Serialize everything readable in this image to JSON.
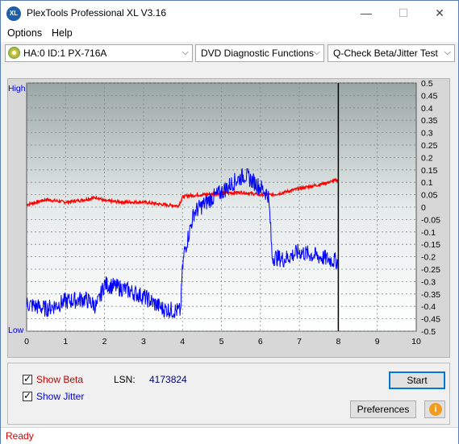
{
  "window": {
    "title": "PlexTools Professional XL V3.16",
    "icon_text": "XL"
  },
  "controls": {
    "minimize": "—",
    "maximize": "☐",
    "close": "✕"
  },
  "menu": {
    "options": "Options",
    "help": "Help"
  },
  "toolbar": {
    "drive": "HA:0 ID:1  PX-716A",
    "function": "DVD Diagnostic Functions",
    "test": "Q-Check Beta/Jitter Test"
  },
  "chart_data": {
    "type": "line",
    "left_axis": {
      "high_label": "High",
      "low_label": "Low"
    },
    "xlim": [
      0,
      10
    ],
    "x_ticks": [
      "0",
      "1",
      "2",
      "3",
      "4",
      "5",
      "6",
      "7",
      "8",
      "9",
      "10"
    ],
    "ylim_right": [
      -0.5,
      0.5
    ],
    "y_ticks_right": [
      "0.5",
      "0.45",
      "0.4",
      "0.35",
      "0.3",
      "0.25",
      "0.2",
      "0.15",
      "0.1",
      "0.05",
      "0",
      "-0.05",
      "-0.1",
      "-0.15",
      "-0.2",
      "-0.25",
      "-0.3",
      "-0.35",
      "-0.4",
      "-0.45",
      "-0.5"
    ],
    "marker_x": 8.0,
    "grid": true,
    "series": [
      {
        "color": "#ff0000",
        "x": [
          0,
          0.5,
          1,
          1.5,
          1.8,
          2,
          2.5,
          3,
          3.5,
          3.9,
          4.0,
          4.1,
          4.5,
          5,
          5.5,
          6,
          6.25,
          6.3,
          6.5,
          7,
          7.5,
          8
        ],
        "y": [
          0.01,
          0.03,
          0.02,
          0.03,
          0.04,
          0.025,
          0.02,
          0.02,
          0.01,
          0.005,
          0.04,
          0.045,
          0.05,
          0.055,
          0.06,
          0.05,
          0.05,
          0.05,
          0.055,
          0.075,
          0.09,
          0.11
        ]
      },
      {
        "color": "#0000ff",
        "x": [
          0,
          0.5,
          1,
          1.5,
          1.8,
          2,
          2.5,
          3,
          3.5,
          3.95,
          4.0,
          4.05,
          4.3,
          4.7,
          5,
          5.3,
          5.6,
          6,
          6.2,
          6.25,
          6.3,
          6.6,
          7,
          7.5,
          8
        ],
        "y": [
          -0.39,
          -0.41,
          -0.38,
          -0.37,
          -0.4,
          -0.31,
          -0.33,
          -0.36,
          -0.41,
          -0.42,
          -0.25,
          -0.18,
          -0.02,
          0.03,
          0.06,
          0.1,
          0.13,
          0.08,
          0.05,
          -0.05,
          -0.2,
          -0.21,
          -0.18,
          -0.2,
          -0.22
        ]
      }
    ]
  },
  "options_panel": {
    "show_beta": "Show Beta",
    "show_jitter": "Show Jitter",
    "lsn_label": "LSN:",
    "lsn_value": "4173824"
  },
  "buttons": {
    "start": "Start",
    "preferences": "Preferences",
    "info": "i"
  },
  "status": {
    "text": "Ready"
  }
}
